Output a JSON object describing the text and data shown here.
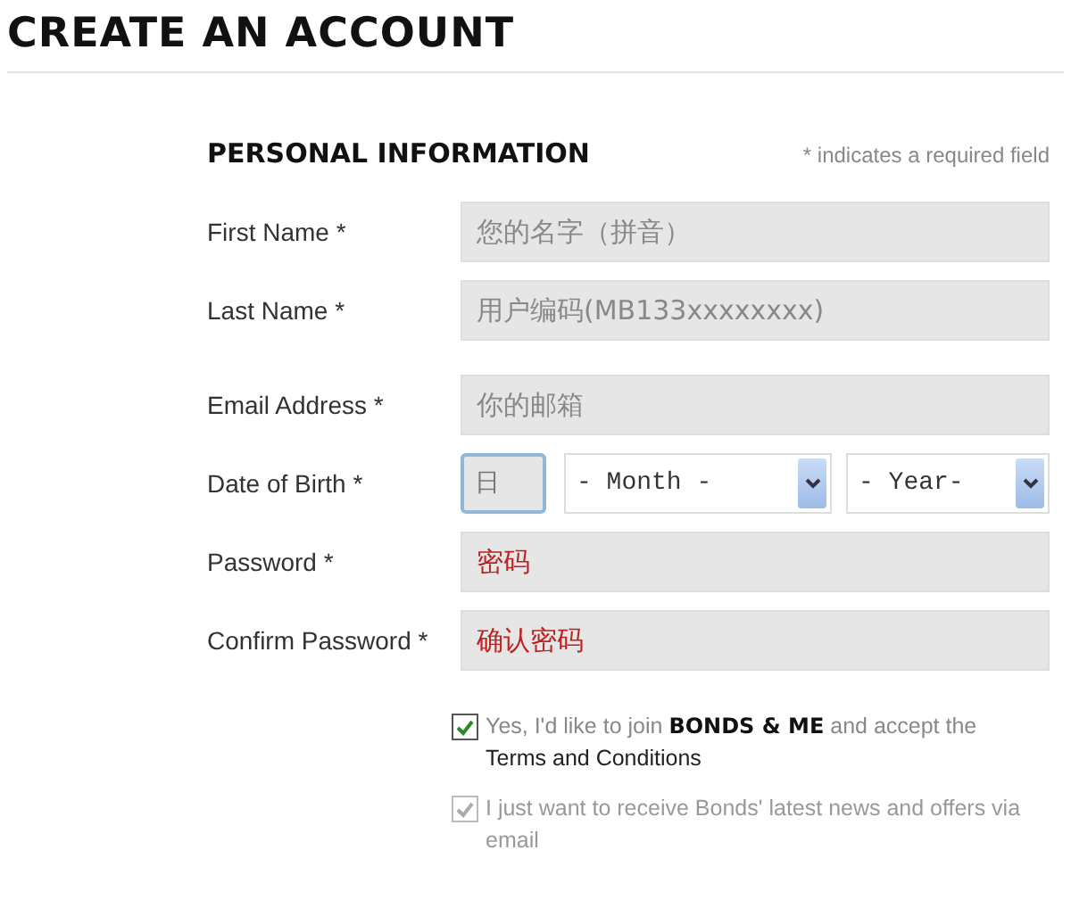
{
  "page_title": "CREATE AN ACCOUNT",
  "section": {
    "title": "PERSONAL INFORMATION",
    "required_note": "* indicates a required field"
  },
  "fields": [
    {
      "kind": "text",
      "label": "First Name *",
      "placeholder": "您的名字（拼音）"
    },
    {
      "kind": "text",
      "label": "Last Name *",
      "placeholder": "用户编码(MB133xxxxxxxx)"
    },
    {
      "kind": "text",
      "label": "Email Address *",
      "placeholder": "你的邮箱"
    },
    {
      "kind": "date",
      "label": "Date of Birth *",
      "day": {
        "placeholder": "日",
        "focused": true
      },
      "month": "- Month -",
      "year": "- Year-"
    },
    {
      "kind": "text",
      "label": "Password *",
      "value": "密码"
    },
    {
      "kind": "text",
      "label": "Confirm Password *",
      "value": "确认密码"
    }
  ],
  "options": [
    {
      "text": "Yes, I'd like to join **BONDS & ME** and accept the",
      "link": "Terms and Conditions",
      "checked": true,
      "disabled": false
    },
    {
      "text": "I just want to receive Bonds' latest news and offers via email",
      "checked": true,
      "disabled": true
    }
  ]
}
